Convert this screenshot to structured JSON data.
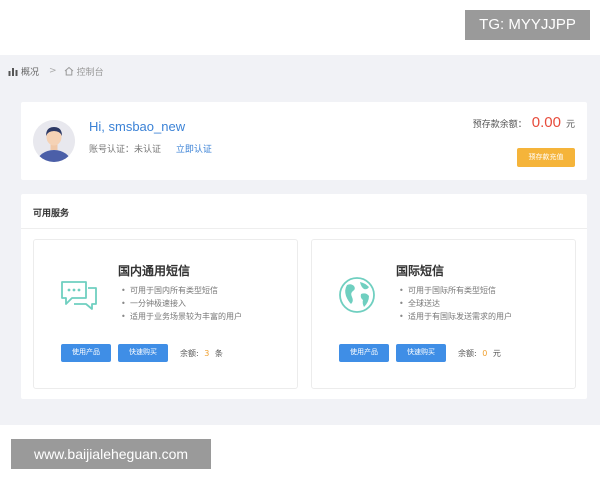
{
  "watermark_top": "TG: MYYJJPP",
  "watermark_bottom": "www.baijialeheguan.com",
  "breadcrumb": {
    "first": "概况",
    "separator": ">",
    "second": "控制台"
  },
  "profile": {
    "greeting": "Hi, smsbao_new",
    "account_status_label": "账号认证：未认证",
    "verify_link": "立即认证"
  },
  "balance": {
    "label": "预存款余额：",
    "amount": "0.00",
    "unit": "元",
    "recharge_button": "预存款充值"
  },
  "services": {
    "title": "可用服务",
    "items": [
      {
        "title": "国内通用短信",
        "icon": "chat-bubbles-icon",
        "points": [
          "可用于国内所有类型短信",
          "一分钟极速接入",
          "适用于业务场景较为丰富的用户"
        ],
        "use_button": "使用产品",
        "buy_button": "快速购买",
        "remain_label": "余额:",
        "remain_value": "3",
        "remain_unit": "条"
      },
      {
        "title": "国际短信",
        "icon": "globe-icon",
        "points": [
          "可用于国际所有类型短信",
          "全球送达",
          "适用于有国际发送需求的用户"
        ],
        "use_button": "使用产品",
        "buy_button": "快速购买",
        "remain_label": "余额:",
        "remain_value": "0",
        "remain_unit": "元"
      }
    ]
  },
  "colors": {
    "accent_blue": "#3f8ee6",
    "recharge_orange": "#f5b43a",
    "amount_red": "#e74c3c",
    "icon_teal": "#6fcfc0"
  }
}
